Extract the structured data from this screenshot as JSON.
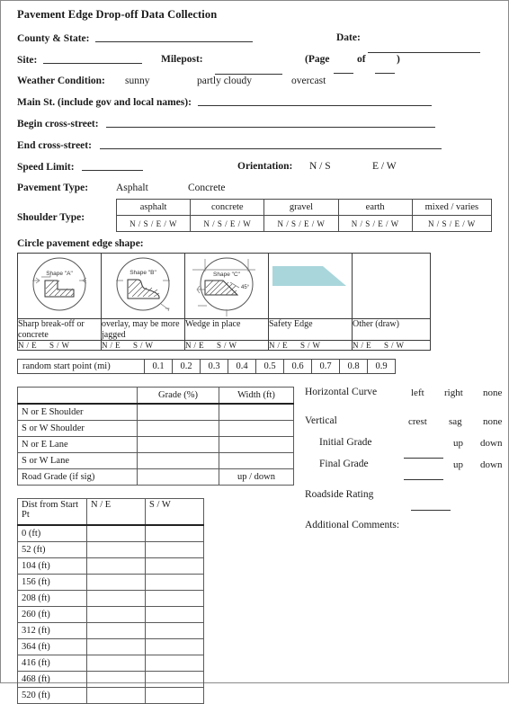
{
  "form": {
    "title": "Pavement Edge Drop-off Data Collection",
    "county_state_label": "County & State:",
    "date_label": "Date:",
    "site_label": "Site:",
    "milepost_label": "Milepost:",
    "page_label_open": "(Page",
    "page_label_of": "of",
    "page_label_close": ")",
    "weather_label": "Weather Condition:",
    "weather_options": [
      "sunny",
      "partly cloudy",
      "overcast"
    ],
    "main_st_label": "Main St. (include gov and local names):",
    "begin_cross_label": "Begin cross-street:",
    "end_cross_label": "End cross-street:",
    "speed_limit_label": "Speed Limit:",
    "orientation_label": "Orientation:",
    "orientation_options": [
      "N / S",
      "E / W"
    ],
    "pavement_type_label": "Pavement Type:",
    "pavement_type_options": [
      "Asphalt",
      "Concrete"
    ],
    "shoulder_type_label": "Shoulder Type:"
  },
  "shoulder_table": {
    "types": [
      "asphalt",
      "concrete",
      "gravel",
      "earth",
      "mixed / varies"
    ],
    "directions": [
      "N / S / E / W",
      "N / S / E / W",
      "N / S / E / W",
      "N / S / E / W",
      "N / S / E / W"
    ]
  },
  "edge_shape": {
    "heading": "Circle pavement edge shape:",
    "cells": [
      {
        "shape_label": "Shape \"A\"",
        "caption": "Sharp break-off or concrete",
        "directions_ne": "N / E",
        "directions_sw": "S / W"
      },
      {
        "shape_label": "Shape \"B\"",
        "caption": "overlay, may be more jagged",
        "directions_ne": "N / E",
        "directions_sw": "S / W"
      },
      {
        "shape_label": "Shape \"C\"",
        "angle_label": "45°",
        "caption": "Wedge in place",
        "directions_ne": "N / E",
        "directions_sw": "S / W"
      },
      {
        "shape_label": "",
        "caption": "Safety Edge",
        "directions_ne": "N / E",
        "directions_sw": "S / W"
      },
      {
        "shape_label": "",
        "caption": "Other (draw)",
        "directions_ne": "N / E",
        "directions_sw": "S / W"
      }
    ],
    "safety_edge_color": "#a9d6db"
  },
  "random_start": {
    "label": "random start point (mi)",
    "values": [
      "0.1",
      "0.2",
      "0.3",
      "0.4",
      "0.5",
      "0.6",
      "0.7",
      "0.8",
      "0.9"
    ]
  },
  "grade_table": {
    "headers": [
      "",
      "Grade (%)",
      "Width (ft)"
    ],
    "rows": [
      {
        "name": "N or E Shoulder",
        "grade": "",
        "width": ""
      },
      {
        "name": "S or W Shoulder",
        "grade": "",
        "width": ""
      },
      {
        "name": "N or E Lane",
        "grade": "",
        "width": ""
      },
      {
        "name": "S or W Lane",
        "grade": "",
        "width": ""
      },
      {
        "name": "Road Grade (if sig)",
        "grade": "",
        "width": "up / down"
      }
    ]
  },
  "dist_table": {
    "headers": [
      "Dist from Start Pt",
      "N / E",
      "S / W"
    ],
    "rows": [
      "0 (ft)",
      "52 (ft)",
      "104 (ft)",
      "156 (ft)",
      "208 (ft)",
      "260 (ft)",
      "312 (ft)",
      "364 (ft)",
      "416 (ft)",
      "468 (ft)",
      "520 (ft)"
    ]
  },
  "right_column": {
    "horizontal_curve_label": "Horizontal Curve",
    "horizontal_curve_options": [
      "left",
      "right",
      "none"
    ],
    "vertical_label": "Vertical",
    "vertical_options": [
      "crest",
      "sag",
      "none"
    ],
    "initial_grade_label": "Initial Grade",
    "initial_grade_options": [
      "up",
      "down"
    ],
    "final_grade_label": "Final Grade",
    "final_grade_options": [
      "up",
      "down"
    ],
    "roadside_rating_label": "Roadside Rating",
    "additional_comments_label": "Additional Comments:"
  }
}
